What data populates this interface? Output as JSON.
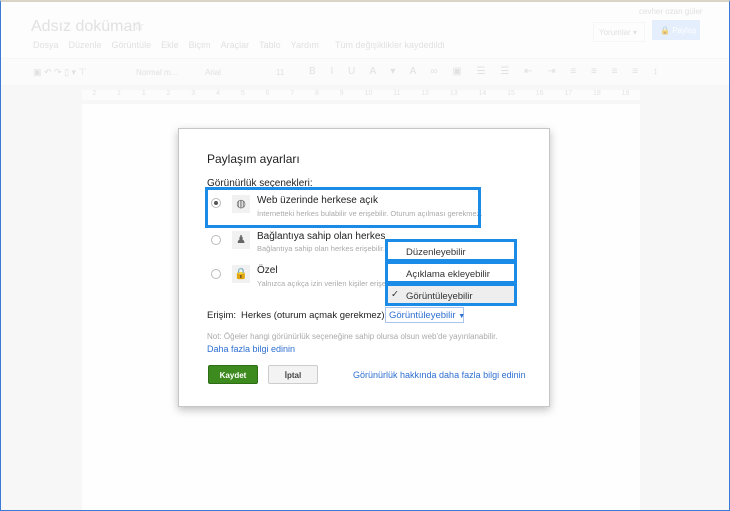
{
  "header": {
    "title": "Adsız doküman",
    "user": "cevher ozan güler",
    "comments_button": "Yorumlar",
    "share_button": "Paylaş",
    "menu": [
      "Dosya",
      "Düzenle",
      "Görüntüle",
      "Ekle",
      "Biçim",
      "Araçlar",
      "Tablo",
      "Yardım"
    ],
    "save_status": "Tüm değişiklikler kaydedildi"
  },
  "toolbar": {
    "style": "Normal m...",
    "font": "Arial",
    "size": "11"
  },
  "ruler": [
    "2",
    "1",
    "1",
    "2",
    "3",
    "4",
    "5",
    "6",
    "7",
    "8",
    "9",
    "10",
    "11",
    "12",
    "13",
    "14",
    "15",
    "16",
    "17",
    "18",
    "19"
  ],
  "dialog": {
    "title": "Paylaşım ayarları",
    "section_label": "Görünürlük seçenekleri:",
    "options": [
      {
        "label": "Web üzerinde herkese açık",
        "desc": "İnternetteki herkes bulabilir ve erişebilir. Oturum açılması gerekmez.",
        "selected": true,
        "icon": "globe-icon"
      },
      {
        "label": "Bağlantıya sahip olan herkes",
        "desc": "Bağlantıya sahip olan herkes erişebilir.",
        "selected": false,
        "icon": "people-icon"
      },
      {
        "label": "Özel",
        "desc": "Yalnızca açıkça izin verilen kişiler erişebilir.",
        "selected": false,
        "icon": "lock-icon"
      }
    ],
    "access_label": "Erişim:",
    "access_value": "Herkes (oturum açmak gerekmez)",
    "access_select": "Görüntüleyebilir",
    "permission_menu": [
      "Düzenleyebilir",
      "Açıklama ekleyebilir",
      "Görüntüleyebilir"
    ],
    "permission_checked": "Görüntüleyebilir",
    "note": "Not: Öğeler hangi görünürlük seçeneğine sahip olursa olsun web'de yayınlanabilir.",
    "learn_more": "Daha fazla bilgi edinin",
    "save": "Kaydet",
    "cancel": "İptal",
    "visibility_link": "Görünürlük hakkında daha fazla bilgi edinin"
  },
  "colors": {
    "highlight": "#1a8ce8",
    "save_button": "#3d8b1f",
    "link": "#2e6fd1"
  }
}
